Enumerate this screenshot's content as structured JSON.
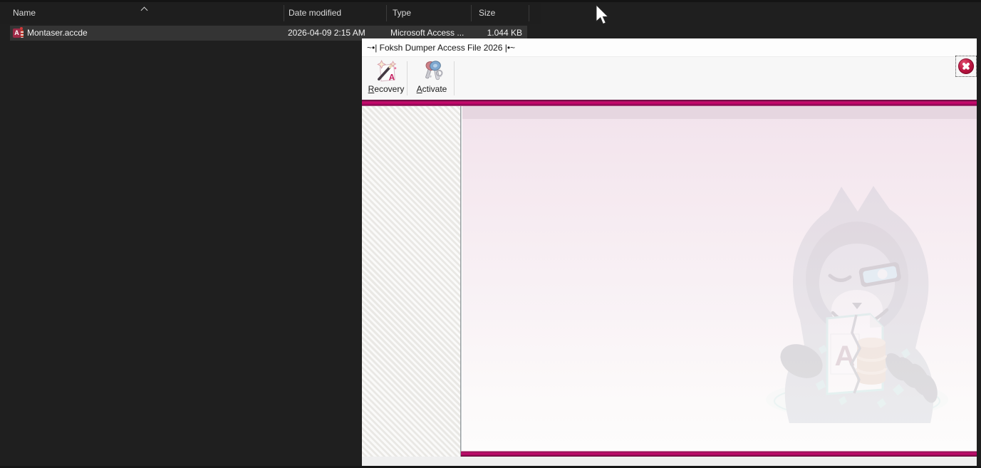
{
  "explorer": {
    "columns": [
      {
        "label": "Name"
      },
      {
        "label": "Date modified"
      },
      {
        "label": "Type"
      },
      {
        "label": "Size"
      }
    ],
    "file": {
      "name": "Montaser.accde",
      "icon_letter": "A",
      "date_modified": "2026-04-09 2:15 AM",
      "type": "Microsoft Access ...",
      "size": "1.044 KB"
    }
  },
  "dialog": {
    "title": "~•| Foksh Dumper Access File 2026 |•~",
    "toolbar": {
      "recovery": {
        "key": "R",
        "rest": "ecovery"
      },
      "activate": {
        "key": "A",
        "rest": "ctivate"
      }
    },
    "icons": {
      "recovery": "magic-wand-icon",
      "activate": "keys-icon",
      "close": "close-icon",
      "sort": "chevron-up-icon",
      "file": "access-file-icon"
    },
    "watermark": {
      "file_letter": "A"
    },
    "colors": {
      "accent_magenta": "#ce0a72",
      "close_red": "#b5123e",
      "content_pink": "#f6ebf1",
      "explorer_bg": "#1f1f1f",
      "row_highlight": "#343434"
    }
  }
}
